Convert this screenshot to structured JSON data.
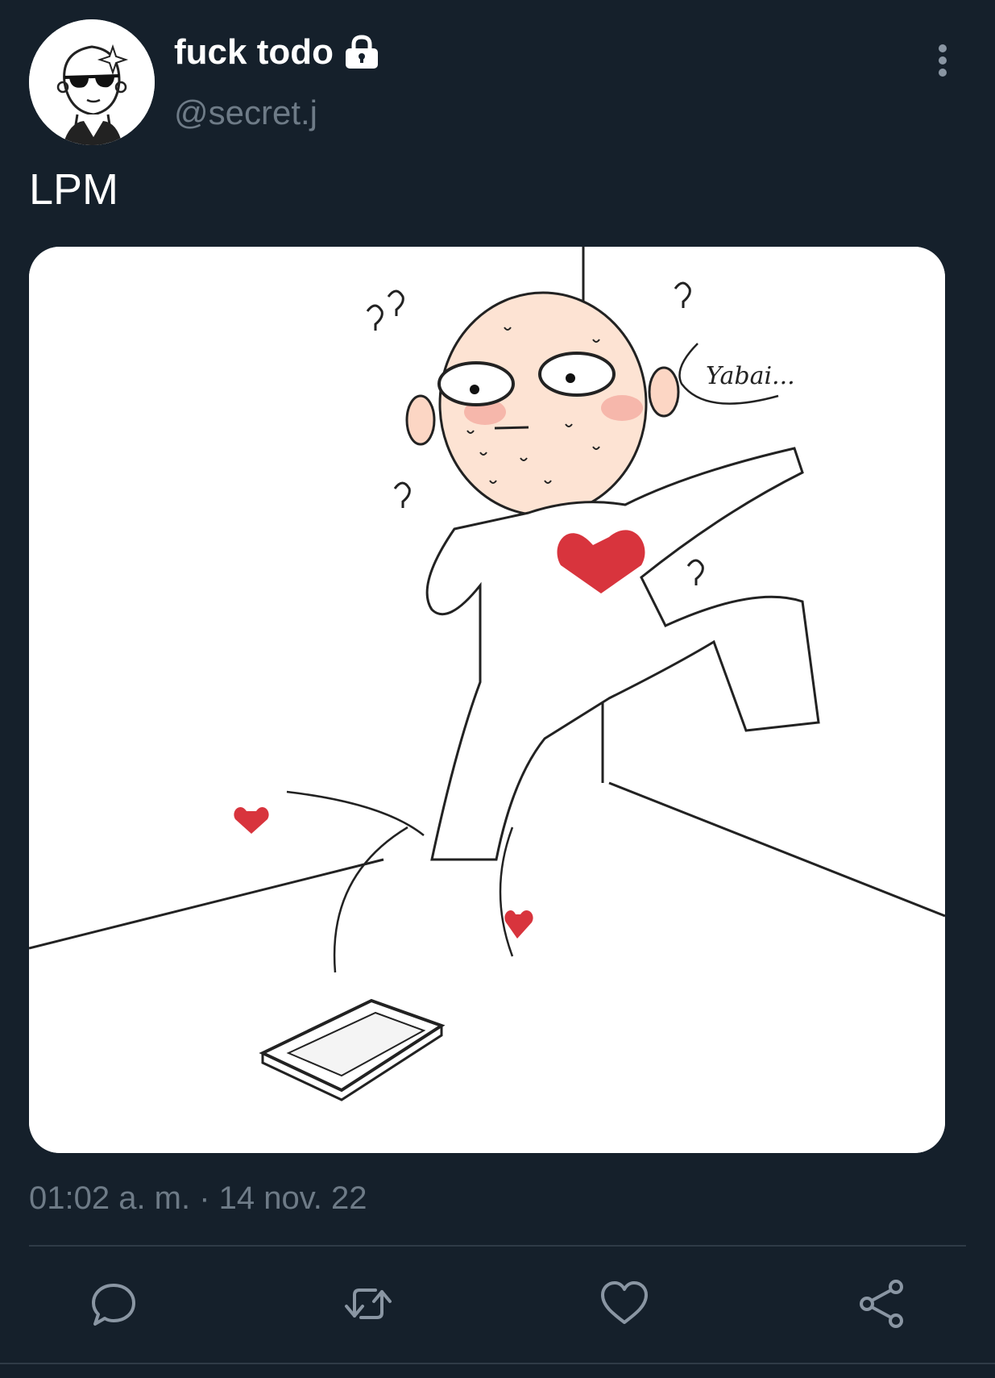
{
  "user": {
    "display_name": "fuck todo",
    "handle": "@secret.j",
    "protected_icon": "lock-icon",
    "avatar_icon": "cartoon-sunglasses-avatar"
  },
  "tweet": {
    "text": "LPM",
    "image_caption_text": "Yabai...",
    "timestamp": "01:02 a. m. · 14 nov. 22"
  },
  "actions": [
    {
      "icon": "reply-icon"
    },
    {
      "icon": "retweet-icon"
    },
    {
      "icon": "like-icon"
    },
    {
      "icon": "share-icon"
    }
  ],
  "colors": {
    "background": "#15202b",
    "secondary_text": "#6e7b87",
    "divider": "#2f3b47",
    "heart": "#d8343d"
  }
}
